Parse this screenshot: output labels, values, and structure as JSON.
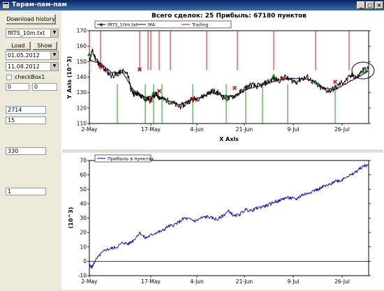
{
  "window": {
    "title": "Тарам-пам-пам",
    "minimize": "_",
    "maximize": "□",
    "close": "×"
  },
  "left_panel": {
    "download_button": "Download history",
    "file_combo": "fRTS_10m.txt",
    "load_button": "Load",
    "show_button": "Show",
    "date_from": "01.05.2012",
    "date_to": "11.08.2012",
    "checkbox_label": "checkBox1",
    "field_a": "0",
    "field_b": "0",
    "field_c": "2714",
    "field_d": "15",
    "field_e": "330",
    "field_f": "1"
  },
  "chart_data": [
    {
      "type": "line",
      "title": "Всего сделок:  25 Прибыль: 67180 пунктов",
      "xlabel": "X Axis",
      "ylabel": "Y Axis (10^3)",
      "ylim": [
        110,
        170
      ],
      "yticks": [
        "110",
        "120",
        "130",
        "140",
        "150",
        "160",
        "170"
      ],
      "xticks": [
        "2-May",
        "17-May",
        "4-Jun",
        "21-Jun",
        "9-Jul",
        "26-Jul"
      ],
      "legend": [
        "fRTS_10m.txt",
        "MA",
        "Trailing"
      ],
      "series": [
        {
          "name": "fRTS_10m.txt",
          "color": "#000000",
          "x": [
            0,
            1,
            2,
            3,
            4,
            5,
            6,
            8,
            10,
            12,
            14,
            15,
            16,
            17,
            18,
            19,
            20,
            21,
            22,
            23,
            24,
            25,
            26,
            28,
            30,
            32,
            34,
            36,
            38,
            40,
            42,
            44,
            46,
            48,
            50,
            52,
            54,
            56,
            58,
            60,
            62,
            64,
            66,
            68,
            70,
            72,
            74,
            76,
            78,
            80,
            82,
            84,
            86,
            88,
            90,
            92,
            94,
            96,
            98,
            100
          ],
          "y": [
            150,
            157,
            153,
            150,
            147,
            146,
            144,
            141,
            142,
            144,
            141,
            131,
            129,
            130,
            128,
            127,
            126,
            126,
            125,
            128,
            129,
            127,
            126,
            125,
            123,
            121,
            122,
            125,
            126,
            127,
            129,
            131,
            130,
            127,
            126,
            128,
            130,
            133,
            135,
            134,
            135,
            137,
            139,
            138,
            140,
            138,
            137,
            139,
            140,
            137,
            134,
            132,
            131,
            133,
            136,
            138,
            141,
            140,
            145,
            145
          ]
        },
        {
          "name": "MA",
          "color": "#000080",
          "x": [
            0,
            4,
            8,
            12,
            16,
            20,
            24,
            28,
            32,
            36,
            40,
            44,
            48,
            52,
            56,
            60,
            64,
            68,
            72,
            76,
            80,
            84,
            88,
            92,
            96,
            100
          ],
          "y": [
            151,
            149,
            143,
            143,
            131,
            127,
            128,
            125,
            122,
            125,
            127,
            130,
            128,
            128,
            132,
            134,
            136,
            138,
            139,
            139,
            138,
            133,
            132,
            136,
            140,
            144
          ]
        }
      ],
      "entries": [
        {
          "x": 0,
          "y": 155,
          "kind": "buy"
        },
        {
          "x": 4,
          "y": 147,
          "kind": "sell"
        },
        {
          "x": 10,
          "y": 142,
          "kind": "buy"
        },
        {
          "x": 18,
          "y": 145,
          "kind": "sell"
        },
        {
          "x": 20,
          "y": 127,
          "kind": "buy"
        },
        {
          "x": 22,
          "y": 125,
          "kind": "sell"
        },
        {
          "x": 23,
          "y": 130,
          "kind": "buy"
        },
        {
          "x": 25,
          "y": 131,
          "kind": "sell"
        },
        {
          "x": 28,
          "y": 125,
          "kind": "buy"
        },
        {
          "x": 37,
          "y": 126,
          "kind": "sell"
        },
        {
          "x": 49,
          "y": 128,
          "kind": "buy"
        },
        {
          "x": 52,
          "y": 133,
          "kind": "sell"
        },
        {
          "x": 66,
          "y": 141,
          "kind": "buy"
        },
        {
          "x": 69,
          "y": 139,
          "kind": "sell"
        },
        {
          "x": 81,
          "y": 137,
          "kind": "buy"
        },
        {
          "x": 88,
          "y": 137,
          "kind": "sell"
        },
        {
          "x": 98,
          "y": 144,
          "kind": "buy"
        }
      ],
      "signals": [
        {
          "x": 0,
          "dir": "up"
        },
        {
          "x": 4,
          "dir": "up"
        },
        {
          "x": 10,
          "dir": "down"
        },
        {
          "x": 18,
          "dir": "up"
        },
        {
          "x": 20,
          "dir": "down"
        },
        {
          "x": 21,
          "dir": "up"
        },
        {
          "x": 22,
          "dir": "up"
        },
        {
          "x": 23,
          "dir": "down"
        },
        {
          "x": 25,
          "dir": "up"
        },
        {
          "x": 26,
          "dir": "down"
        },
        {
          "x": 29,
          "dir": "up"
        },
        {
          "x": 37,
          "dir": "down"
        },
        {
          "x": 42,
          "dir": "up"
        },
        {
          "x": 49,
          "dir": "down"
        },
        {
          "x": 53,
          "dir": "up"
        },
        {
          "x": 56,
          "dir": "down"
        },
        {
          "x": 62,
          "dir": "down"
        },
        {
          "x": 66,
          "dir": "up"
        },
        {
          "x": 71,
          "dir": "down"
        },
        {
          "x": 81,
          "dir": "up"
        },
        {
          "x": 88,
          "dir": "down"
        },
        {
          "x": 93,
          "dir": "up"
        }
      ]
    },
    {
      "type": "line",
      "ylabel": "(10^3)",
      "ylim": [
        -10,
        70
      ],
      "yticks": [
        "-10",
        "0",
        "10",
        "20",
        "30",
        "40",
        "50",
        "60",
        "70"
      ],
      "xticks": [
        "2-May",
        "17-May",
        "4-Jun",
        "21-Jun",
        "9-Jul",
        "26-Jul"
      ],
      "legend": [
        "Прибыль в пунктах"
      ],
      "series": [
        {
          "name": "Прибыль в пунктах",
          "color": "#0000c0",
          "x": [
            0,
            1,
            2,
            4,
            6,
            8,
            10,
            12,
            14,
            16,
            18,
            20,
            22,
            24,
            26,
            28,
            30,
            32,
            34,
            36,
            38,
            40,
            42,
            44,
            46,
            48,
            50,
            52,
            54,
            56,
            58,
            60,
            62,
            64,
            66,
            68,
            70,
            72,
            74,
            76,
            78,
            80,
            82,
            84,
            86,
            88,
            90,
            92,
            94,
            96,
            98,
            100
          ],
          "y": [
            -3,
            -4,
            0,
            5,
            8,
            9,
            10,
            13,
            12,
            15,
            20,
            16,
            18,
            20,
            21,
            24,
            25,
            27,
            30,
            29,
            28,
            30,
            31,
            30,
            29,
            32,
            35,
            31,
            33,
            36,
            35,
            37,
            38,
            39,
            41,
            42,
            44,
            44,
            43,
            46,
            47,
            49,
            50,
            52,
            53,
            56,
            56,
            59,
            60,
            63,
            66,
            67
          ]
        }
      ]
    }
  ]
}
